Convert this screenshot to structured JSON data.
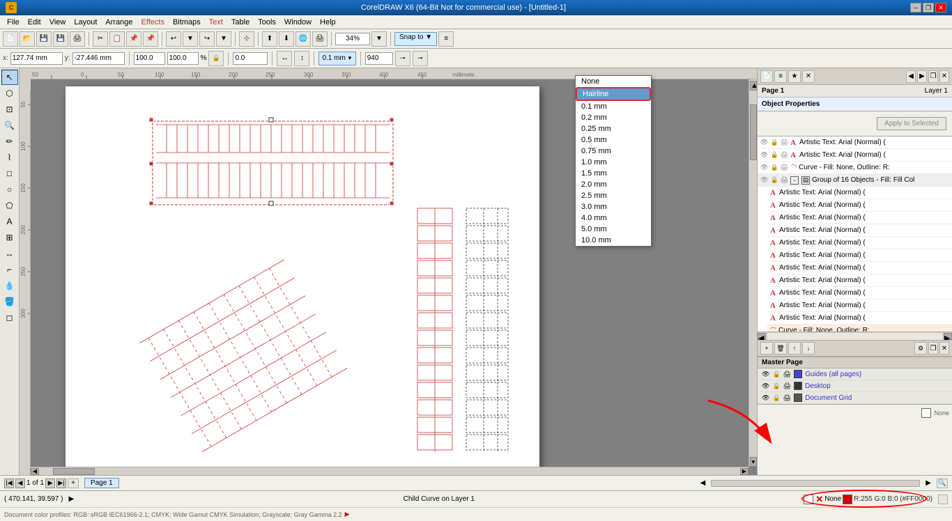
{
  "app": {
    "title": "CorelDRAW X6 (64-Bit Not for commercial use) - [Untitled-1]",
    "icon": "C"
  },
  "titlebar": {
    "title": "CorelDRAW X6 (64-Bit Not for commercial use) - [Untitled-1]",
    "minimize": "─",
    "restore": "❐",
    "close": "✕",
    "inner_minimize": "─",
    "inner_restore": "❐",
    "inner_close": "✕"
  },
  "menubar": {
    "items": [
      "File",
      "Edit",
      "View",
      "Layout",
      "Arrange",
      "Effects",
      "Bitmaps",
      "Text",
      "Table",
      "Tools",
      "Window",
      "Help"
    ]
  },
  "toolbar": {
    "zoom": "34%",
    "snap": "Snap to",
    "x_label": "x:",
    "x_value": "127.74 mm",
    "y_label": "y:",
    "y_value": "-27.446 mm",
    "w_value": "100.0",
    "h_value": "100.0",
    "angle": "0.0"
  },
  "linewidth": {
    "current": "0.1 mm",
    "options": [
      {
        "label": "None",
        "value": "none"
      },
      {
        "label": "Hairline",
        "value": "hairline",
        "selected": true
      },
      {
        "label": "0.1 mm",
        "value": "0.1"
      },
      {
        "label": "0.2 mm",
        "value": "0.2"
      },
      {
        "label": "0.25 mm",
        "value": "0.25"
      },
      {
        "label": "0.5 mm",
        "value": "0.5"
      },
      {
        "label": "0.75 mm",
        "value": "0.75"
      },
      {
        "label": "1.0 mm",
        "value": "1.0"
      },
      {
        "label": "1.5 mm",
        "value": "1.5"
      },
      {
        "label": "2.0 mm",
        "value": "2.0"
      },
      {
        "label": "2.5 mm",
        "value": "2.5"
      },
      {
        "label": "3.0 mm",
        "value": "3.0"
      },
      {
        "label": "4.0 mm",
        "value": "4.0"
      },
      {
        "label": "5.0 mm",
        "value": "5.0"
      },
      {
        "label": "10.0 mm",
        "value": "10.0"
      }
    ]
  },
  "object_properties": {
    "title": "Object Properties"
  },
  "apply_button": "Apply to Selected",
  "layers": {
    "page_label": "Page 1",
    "layer_label": "Layer 1",
    "items": [
      {
        "type": "text",
        "label": "Artistic Text: Arial (Normal) (",
        "indent": 1
      },
      {
        "type": "text",
        "label": "Artistic Text: Arial (Normal) (",
        "indent": 1
      },
      {
        "type": "curve",
        "label": "Curve - Fill: None, Outline: R:",
        "indent": 1
      },
      {
        "type": "group",
        "label": "Group of 16 Objects - Fill: Fill Col",
        "indent": 1,
        "is_group": true
      },
      {
        "type": "text",
        "label": "Artistic Text: Arial (Normal) (",
        "indent": 2
      },
      {
        "type": "text",
        "label": "Artistic Text: Arial (Normal) (",
        "indent": 2
      },
      {
        "type": "text",
        "label": "Artistic Text: Arial (Normal) (",
        "indent": 2
      },
      {
        "type": "text",
        "label": "Artistic Text: Arial (Normal) (",
        "indent": 2
      },
      {
        "type": "text",
        "label": "Artistic Text: Arial (Normal) (",
        "indent": 2
      },
      {
        "type": "text",
        "label": "Artistic Text: Arial (Normal) (",
        "indent": 2
      },
      {
        "type": "text",
        "label": "Artistic Text: Arial (Normal) (",
        "indent": 2
      },
      {
        "type": "text",
        "label": "Artistic Text: Arial (Normal) (",
        "indent": 2
      },
      {
        "type": "text",
        "label": "Artistic Text: Arial (Normal) (",
        "indent": 2
      },
      {
        "type": "text",
        "label": "Artistic Text: Arial (Normal) (",
        "indent": 2
      },
      {
        "type": "text",
        "label": "Artistic Text: Arial (Normal) (",
        "indent": 2
      },
      {
        "type": "curve",
        "label": "Curve - Fill: None, Outline: R:",
        "indent": 2
      }
    ]
  },
  "master_page": {
    "title": "Master Page",
    "items": [
      {
        "label": "Guides (all pages)",
        "color": "#4444cc"
      },
      {
        "label": "Desktop",
        "color": "#333333"
      },
      {
        "label": "Document Grid",
        "color": "#333333"
      }
    ]
  },
  "statusbar": {
    "coords": "( 470.141, 39.597 )",
    "status": "Child Curve on Layer 1",
    "color_profile": "Document color profiles: RGB: sRGB IEC61966-2.1; CMYK: Wide Gamut CMYK Simulation; Grayscale: Gray Gamma 2.2"
  },
  "page": {
    "current": "1",
    "total": "1",
    "label": "Page 1"
  },
  "fill_status": {
    "fill": "None",
    "outline": "None",
    "outline_color": "R:255 G:0 B:0 (#FF0000)"
  },
  "colors": {
    "accent_blue": "#316ac5",
    "highlight_red": "#cc3333",
    "toolbar_bg": "#f0f0e8",
    "canvas_bg": "#808080"
  }
}
